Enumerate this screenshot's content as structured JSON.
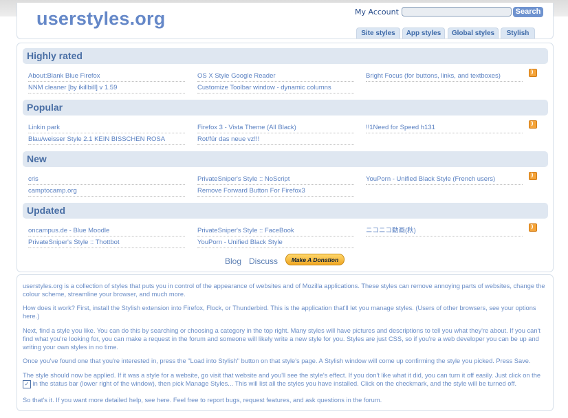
{
  "header": {
    "logo": "userstyles.org",
    "my_account": "My Account",
    "search_value": "",
    "search_button": "Search",
    "tabs": [
      "Site styles",
      "App styles",
      "Global styles",
      "Stylish"
    ]
  },
  "sections": [
    {
      "title": "Highly rated",
      "items": [
        "About:Blank Blue Firefox",
        "OS X Style Google Reader",
        "Bright Focus (for buttons, links, and textboxes)",
        "NNM cleaner [by ikillbill] v 1.59",
        "Customize Toolbar window - dynamic columns"
      ]
    },
    {
      "title": "Popular",
      "items": [
        "Linkin park",
        "Firefox 3 - Vista Theme (All Black)",
        "!!1Need for Speed h131",
        "Blau/weisser Style 2.1 KEIN BISSCHEN ROSA",
        "Rot/für das neue vz!!!"
      ]
    },
    {
      "title": "New",
      "items": [
        "cris",
        "PrivateSniper's Style :: NoScript",
        "YouPorn - Unified Black Style (French users)",
        "camptocamp.org",
        "Remove Forward Button For Firefox3"
      ]
    },
    {
      "title": "Updated",
      "items": [
        "oncampus.de - Blue Moodle",
        "PrivateSniper's Style :: FaceBook",
        "ニコニコ動画(秋)",
        "PrivateSniper's Style :: Thottbot",
        "YouPorn - Unified Black Style"
      ]
    }
  ],
  "footer_links": {
    "blog": "Blog",
    "discuss": "Discuss",
    "donate": "Make A Donation"
  },
  "info": {
    "p1": "userstyles.org is a collection of styles that puts you in control of the appearance of websites and of Mozilla applications. These styles can remove annoying parts of websites, change the colour scheme, streamline your browser, and much more.",
    "p2": "How does it work? First, install the Stylish extension into Firefox, Flock, or Thunderbird. This is the application that'll let you manage styles. (Users of other browsers, see your options here.)",
    "p3": "Next, find a style you like. You can do this by searching or choosing a category in the top right. Many styles will have pictures and descriptions to tell you what they're about. If you can't find what you're looking for, you can make a request in the forum and someone will likely write a new style for you. Styles are just CSS, so if you're a web developer you can be up and writing your own styles in no time.",
    "p4": "Once you've found one that you're interested in, press the \"Load into Stylish\" button on that style's page. A Stylish window will come up confirming the style you picked. Press Save.",
    "p5a": "The style should now be applied. If it was a style for a website, go visit that website and you'll see the style's effect. If you don't like what it did, you can turn it off easily. Just click on the",
    "p5b": "in the status bar (lower right of the window), then pick Manage Styles... This will list all the styles you have installed. Click on the checkmark, and the style will be turned off.",
    "p6": "So that's it. If you want more detailed help, see here. Feel free to report bugs, request features, and ask questions in the forum."
  },
  "colors": {
    "accent": "#6588c8",
    "link": "#5a81c2",
    "section_bg": "#dfe7f1",
    "rss": "#f4a43a"
  }
}
